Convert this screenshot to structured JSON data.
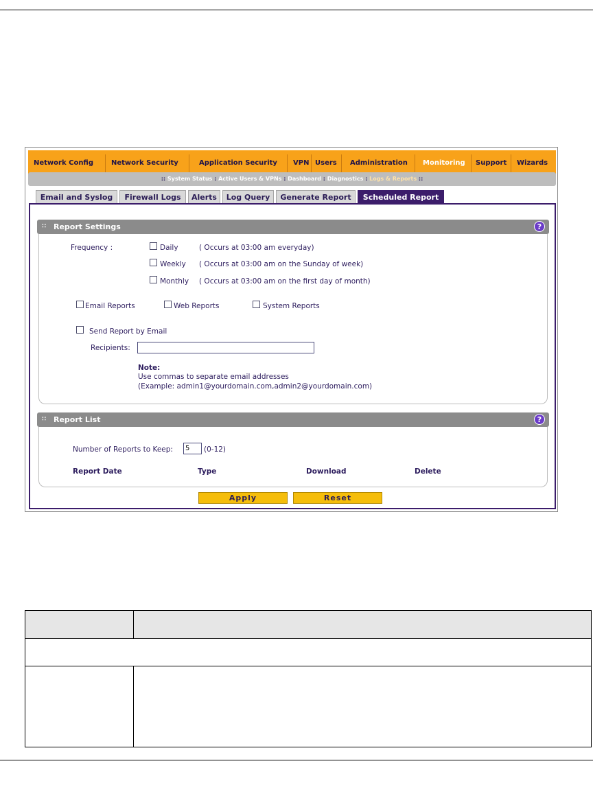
{
  "nav": {
    "items": [
      {
        "label": "Network Config",
        "active": false
      },
      {
        "label": "Network Security",
        "active": false
      },
      {
        "label": "Application Security",
        "active": false
      },
      {
        "label": "VPN",
        "active": false
      },
      {
        "label": "Users",
        "active": false
      },
      {
        "label": "Administration",
        "active": false
      },
      {
        "label": "Monitoring",
        "active": true
      },
      {
        "label": "Support",
        "active": false
      },
      {
        "label": "Wizards",
        "active": false
      }
    ]
  },
  "subnav": {
    "prefix": ":: ",
    "items": [
      "System Status",
      "Active Users & VPNs",
      "Dashboard",
      "Diagnostics",
      "Logs & Reports"
    ],
    "separator": " : ",
    "suffix": " ::"
  },
  "tabs": [
    {
      "label": "Email and Syslog",
      "active": false
    },
    {
      "label": "Firewall Logs",
      "active": false
    },
    {
      "label": "Alerts",
      "active": false
    },
    {
      "label": "Log Query",
      "active": false
    },
    {
      "label": "Generate Report",
      "active": false
    },
    {
      "label": "Scheduled Report",
      "active": true
    }
  ],
  "report_settings": {
    "title": "Report Settings",
    "help": "?",
    "frequency_label": "Frequency :",
    "frequency": [
      {
        "label": "Daily",
        "note": "( Occurs at 03:00 am everyday)",
        "checked": false
      },
      {
        "label": "Weekly",
        "note": "( Occurs at 03:00 am on the Sunday of week)",
        "checked": false
      },
      {
        "label": "Monthly",
        "note": "( Occurs at 03:00 am on the first day of month)",
        "checked": false
      }
    ],
    "report_types": [
      {
        "label": "Email Reports",
        "checked": false
      },
      {
        "label": "Web Reports",
        "checked": false
      },
      {
        "label": "System Reports",
        "checked": false
      }
    ],
    "send_by_email_label": "Send Report by Email",
    "send_by_email_checked": false,
    "recipients_label": "Recipients:",
    "recipients_value": "",
    "note_title": "Note:",
    "note_line1": "Use commas to separate email addresses",
    "note_line2": "(Example: admin1@yourdomain.com,admin2@yourdomain.com)"
  },
  "report_list": {
    "title": "Report List",
    "help": "?",
    "keep_label": "Number of Reports to Keep:",
    "keep_value": "5",
    "keep_range": "(0-12)",
    "columns": [
      "Report Date",
      "Type",
      "Download",
      "Delete"
    ]
  },
  "buttons": {
    "apply": "Apply",
    "reset": "Reset"
  },
  "colors": {
    "nav_bg": "#f8a21a",
    "tab_active": "#3c1d6b",
    "panel_head": "#8b8b8b",
    "button": "#f5bd0b",
    "help_icon": "#6b3cc8"
  }
}
